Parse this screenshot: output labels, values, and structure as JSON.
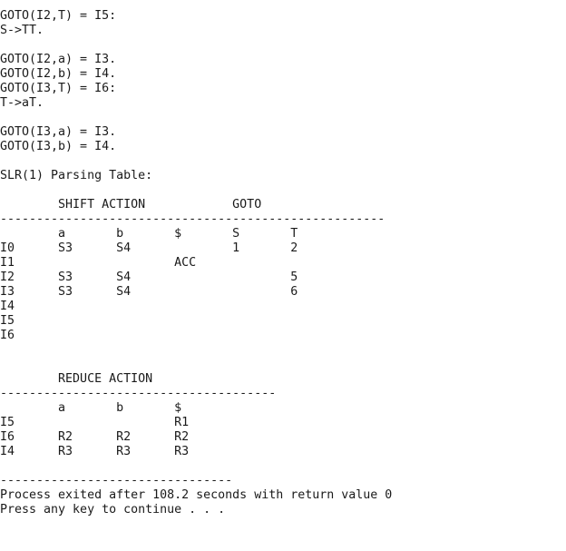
{
  "console": {
    "lines": [
      "GOTO(I2,T) = I5:",
      "S->TT.",
      "",
      "GOTO(I2,a) = I3.",
      "GOTO(I2,b) = I4.",
      "GOTO(I3,T) = I6:",
      "T->aT.",
      "",
      "GOTO(I3,a) = I3.",
      "GOTO(I3,b) = I4.",
      "",
      "SLR(1) Parsing Table:",
      "",
      "        SHIFT ACTION            GOTO",
      "-----------------------------------------------------",
      "        a       b       $       S       T",
      "I0      S3      S4              1       2",
      "I1                      ACC",
      "I2      S3      S4                      5",
      "I3      S3      S4                      6",
      "I4",
      "I5",
      "I6",
      "",
      "",
      "        REDUCE ACTION",
      "--------------------------------------",
      "        a       b       $",
      "I5                      R1",
      "I6      R2      R2      R2",
      "I4      R3      R3      R3",
      "",
      "--------------------------------",
      "Process exited after 108.2 seconds with return value 0",
      "Press any key to continue . . ."
    ]
  }
}
